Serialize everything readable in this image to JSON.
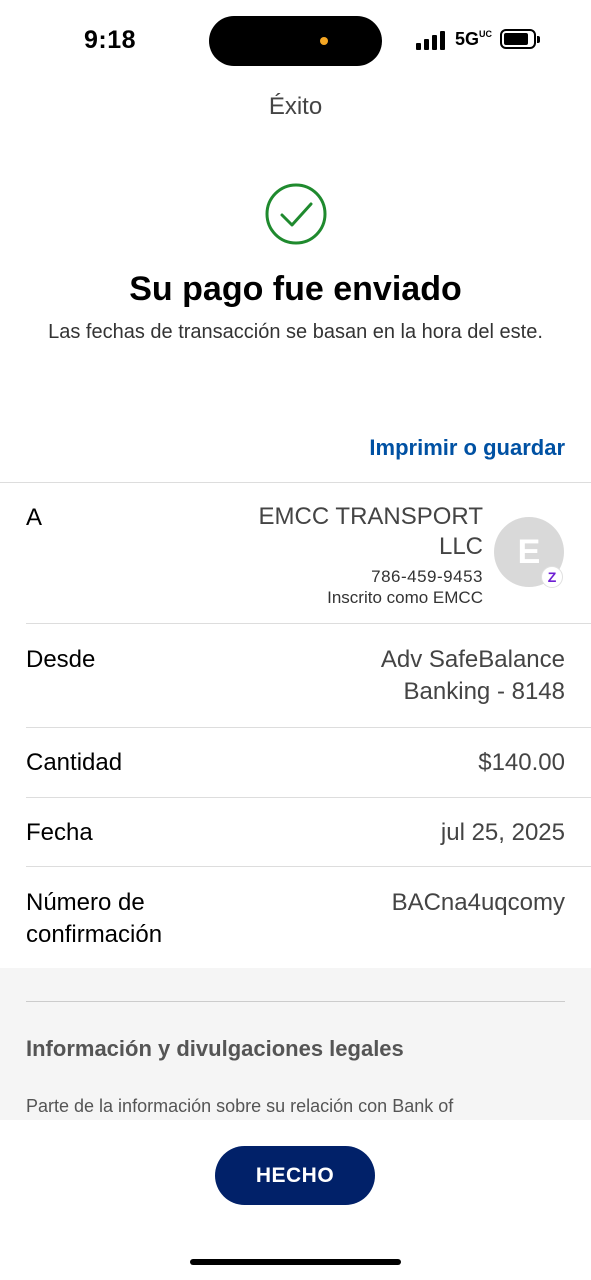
{
  "status_bar": {
    "time": "9:18",
    "network": "5G",
    "network_suffix": "UC",
    "island_dot_color": "#f5a623"
  },
  "nav": {
    "title": "Éxito"
  },
  "success": {
    "icon": "checkmark-circle-icon",
    "icon_color": "#1f8a2e",
    "headline": "Su pago fue enviado",
    "subtext": "Las fechas de transacción se basan en la hora del este."
  },
  "actions": {
    "print_label": "Imprimir o guardar"
  },
  "details": {
    "to": {
      "label": "A",
      "name": "EMCC TRANSPORT LLC",
      "phone": "786-459-9453",
      "enrolled": "Inscrito como EMCC",
      "avatar_initial": "E",
      "badge_icon": "zelle-icon",
      "badge_glyph": "Z"
    },
    "from": {
      "label": "Desde",
      "value": "Adv SafeBalance Banking - 8148"
    },
    "amount": {
      "label": "Cantidad",
      "value": "$140.00"
    },
    "date": {
      "label": "Fecha",
      "value": "jul 25, 2025"
    },
    "confirmation": {
      "label": "Número de confirmación",
      "value": "BACna4uqcomy"
    }
  },
  "legal": {
    "heading": "Información y divulgaciones legales",
    "text": "Parte de la información sobre su relación con Bank of"
  },
  "footer": {
    "done_label": "HECHO"
  },
  "colors": {
    "link": "#0051a3",
    "primary_button": "#012169",
    "zelle": "#6d1ed4"
  }
}
